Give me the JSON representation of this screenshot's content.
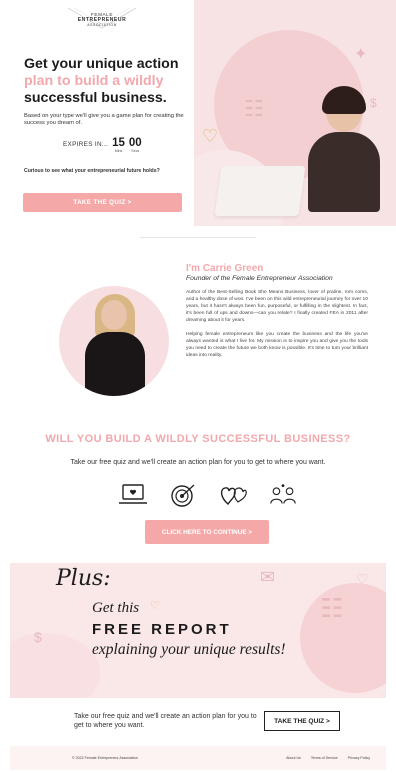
{
  "logo": {
    "line1": "FEMALE",
    "line2": "ENTREPRENEUR",
    "line3": "ASSOCIATION"
  },
  "hero": {
    "title_1": "Get your unique action",
    "title_pink": "plan to build a wildly",
    "title_3": "successful business.",
    "subtitle": "Based on your type we'll give you a game plan for creating the success you dream of.",
    "expires_label": "EXPIRES IN...",
    "minutes": "15",
    "minutes_unit": "Mins",
    "seconds": "00",
    "seconds_unit": "Secs",
    "curious": "Curious to see what your entrepreneurial future holds?",
    "quiz_button": "TAKE THE QUIZ >"
  },
  "about": {
    "title": "I'm Carrie Green",
    "role": "Founder of the Female Entrepreneur Association",
    "para1": "Author of the Best-Selling Book She Means Business, lover of praline, rom coms, and a healthy dose of woo. I've been on this wild entrepreneurial journey for over 10 years, but it hasn't always been fun, purposeful, or fulfilling in the slightest. In fact, it's been full of ups and downs—can you relate? I finally created FEA in 2011 after dreaming about it for years.",
    "para2": "Helping female entrepreneurs like you create the business and the life you've always wanted is what I live for. My mission is to inspire you and give you the tools you need to create the future we both know is possible. It's time to turn your brilliant ideas into reality."
  },
  "will": {
    "title": "WILL YOU BUILD A WILDLY SUCCESSFUL BUSINESS?",
    "subtitle": "Take our free quiz and we'll create an action plan for you to get to where you want.",
    "continue_button": "CLICK HERE TO CONTINUE >"
  },
  "plus": {
    "script": "Plus:",
    "get": "Get this",
    "report": "FREE REPORT",
    "explain": "explaining your unique results!"
  },
  "cta": {
    "text": "Take our free quiz and we'll create an action plan for you to get to where you want.",
    "button": "TAKE THE QUIZ >"
  },
  "footer": {
    "copyright": "© 2022 Female Entrepreneur Association",
    "links": [
      "About Us",
      "Terms of Service",
      "Privacy Policy"
    ]
  },
  "colors": {
    "accent_pink": "#f2a8ad",
    "button_pink": "#f4a9a8",
    "blush_bg": "#f7e3e4"
  }
}
